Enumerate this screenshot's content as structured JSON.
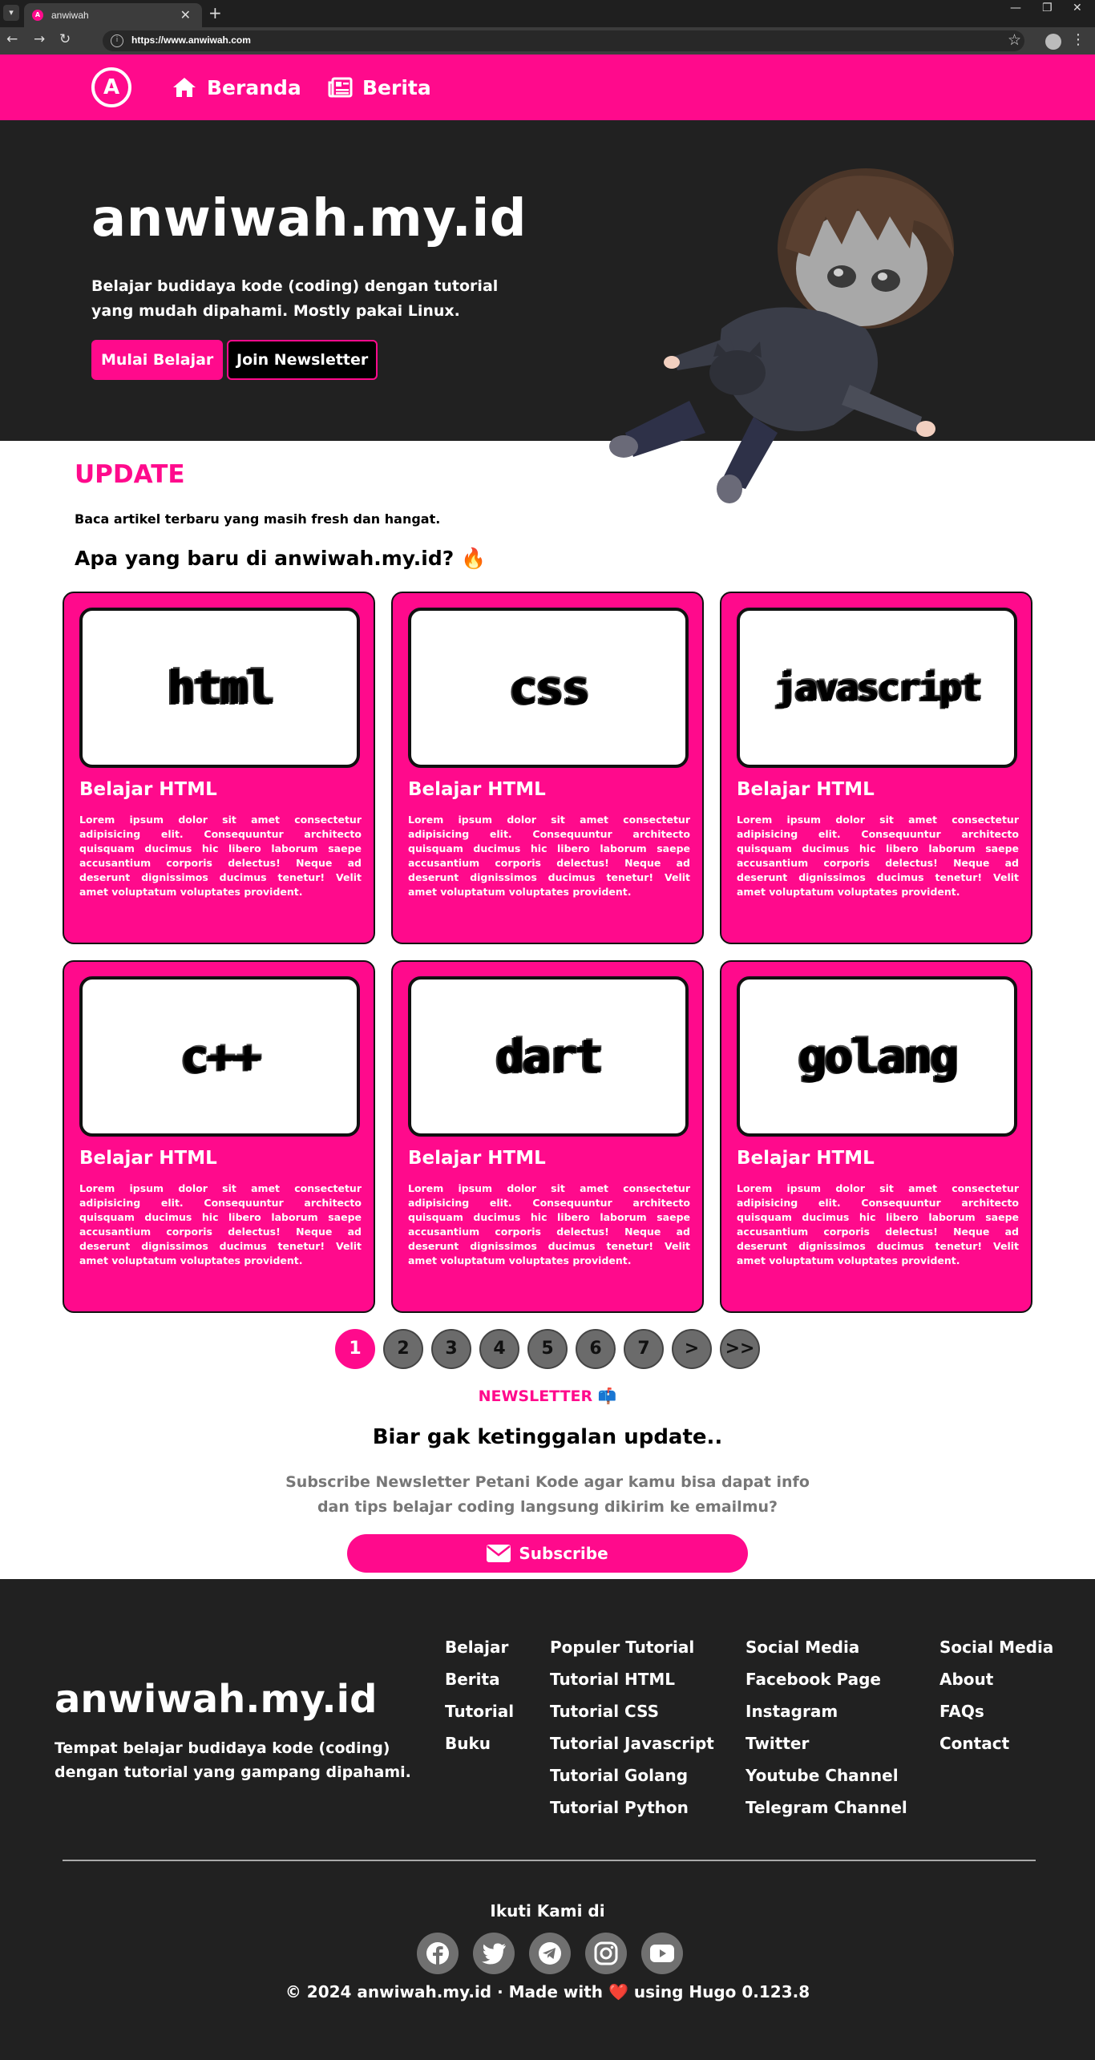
{
  "browser": {
    "tab_title": "anwiwah",
    "url": "https://www.anwiwah.com",
    "favicon_letter": "A"
  },
  "nav": {
    "logo_letter": "A",
    "links": [
      {
        "label": "Beranda",
        "icon": "home-icon"
      },
      {
        "label": "Berita",
        "icon": "newspaper-icon"
      }
    ]
  },
  "hero": {
    "title": "anwiwah.my.id",
    "description": "Belajar budidaya kode (coding) dengan tutorial yang mudah dipahami. Mostly pakai Linux.",
    "primary_button": "Mulai Belajar",
    "secondary_button": "Join Newsletter"
  },
  "update": {
    "heading": "UPDATE",
    "subtitle": "Baca artikel terbaru yang masih fresh dan hangat.",
    "question": "Apa yang baru di anwiwah.my.id? 🔥"
  },
  "cards": [
    {
      "thumb": "html",
      "title": "Belajar HTML",
      "body": "Lorem ipsum dolor sit amet consectetur adipisicing elit. Consequuntur architecto quisquam ducimus hic libero laborum saepe accusantium corporis delectus! Neque ad deserunt dignissimos ducimus tenetur! Velit amet voluptatum voluptates provident."
    },
    {
      "thumb": "css",
      "title": "Belajar HTML",
      "body": "Lorem ipsum dolor sit amet consectetur adipisicing elit. Consequuntur architecto quisquam ducimus hic libero laborum saepe accusantium corporis delectus! Neque ad deserunt dignissimos ducimus tenetur! Velit amet voluptatum voluptates provident."
    },
    {
      "thumb": "javascript",
      "title": "Belajar HTML",
      "body": "Lorem ipsum dolor sit amet consectetur adipisicing elit. Consequuntur architecto quisquam ducimus hic libero laborum saepe accusantium corporis delectus! Neque ad deserunt dignissimos ducimus tenetur! Velit amet voluptatum voluptates provident."
    },
    {
      "thumb": "c++",
      "title": "Belajar HTML",
      "body": "Lorem ipsum dolor sit amet consectetur adipisicing elit. Consequuntur architecto quisquam ducimus hic libero laborum saepe accusantium corporis delectus! Neque ad deserunt dignissimos ducimus tenetur! Velit amet voluptatum voluptates provident."
    },
    {
      "thumb": "dart",
      "title": "Belajar HTML",
      "body": "Lorem ipsum dolor sit amet consectetur adipisicing elit. Consequuntur architecto quisquam ducimus hic libero laborum saepe accusantium corporis delectus! Neque ad deserunt dignissimos ducimus tenetur! Velit amet voluptatum voluptates provident."
    },
    {
      "thumb": "golang",
      "title": "Belajar HTML",
      "body": "Lorem ipsum dolor sit amet consectetur adipisicing elit. Consequuntur architecto quisquam ducimus hic libero laborum saepe accusantium corporis delectus! Neque ad deserunt dignissimos ducimus tenetur! Velit amet voluptatum voluptates provident."
    }
  ],
  "pagination": {
    "pages": [
      "1",
      "2",
      "3",
      "4",
      "5",
      "6",
      "7",
      ">",
      ">>"
    ],
    "active": "1"
  },
  "newsletter": {
    "label": "NEWSLETTER 📫",
    "title": "Biar gak ketinggalan update..",
    "description": "Subscribe Newsletter Petani Kode agar kamu bisa dapat info dan tips belajar coding langsung dikirim ke emailmu?",
    "button": "Subscribe"
  },
  "footer": {
    "title": "anwiwah.my.id",
    "description": "Tempat belajar budidaya kode (coding) dengan tutorial yang gampang dipahami.",
    "columns": [
      [
        "Belajar",
        "Berita",
        "Tutorial",
        "Buku"
      ],
      [
        "Populer Tutorial",
        "Tutorial HTML",
        "Tutorial CSS",
        "Tutorial Javascript",
        "Tutorial Golang",
        "Tutorial Python"
      ],
      [
        "Social Media",
        "Facebook Page",
        "Instagram",
        "Twitter",
        "Youtube Channel",
        "Telegram Channel"
      ],
      [
        "Social Media",
        "About",
        "FAQs",
        "Contact"
      ]
    ],
    "follow_label": "Ikuti Kami di",
    "social_icons": [
      "facebook-icon",
      "twitter-icon",
      "telegram-icon",
      "instagram-icon",
      "youtube-icon"
    ],
    "copyright": "© 2024 anwiwah.my.id · Made with ❤️ using Hugo 0.123.8"
  },
  "colors": {
    "brand_pink": "#ff0a8c",
    "dark_bg": "#212121",
    "pagination_gray": "#6b6b6b"
  }
}
